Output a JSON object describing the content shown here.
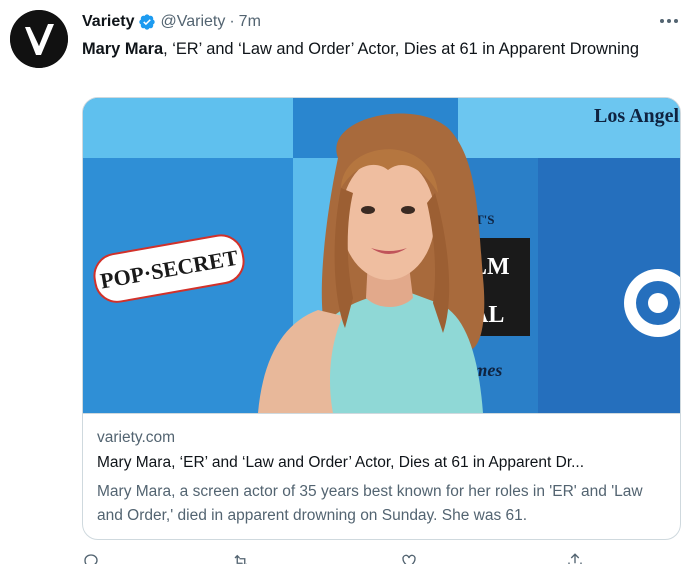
{
  "author": {
    "display_name": "Variety",
    "handle": "@Variety",
    "separator": "·",
    "time": "7m",
    "avatar_letter": "V",
    "verified_color": "#1d9bf0"
  },
  "tweet": {
    "text_bold": "Mary Mara",
    "text_rest": ", ‘ER’ and ‘Law and Order’ Actor, Dies at 61 in Apparent Drowning"
  },
  "card": {
    "domain": "variety.com",
    "title": "Mary Mara, ‘ER’ and ‘Law and Order’ Actor, Dies at 61 in Apparent Dr...",
    "description": "Mary Mara, a screen actor of 35 years best known for her roles in 'ER' and 'Law and Order,' died in apparent drowning on Sunday. She was 61.",
    "image": {
      "backdrop_brand_1": "POP·SECRET",
      "backdrop_text_la": "Los Angel",
      "backdrop_text_times": "Times",
      "backdrop_text_lm": "LM",
      "backdrop_text_al": "AL",
      "backdrop_text_ts": "T'S",
      "backdrop_colors": [
        "#2d8fd5",
        "#55b6ea",
        "#1f73b8"
      ]
    }
  },
  "actions": [
    "reply-icon",
    "retweet-icon",
    "like-icon",
    "share-icon"
  ]
}
